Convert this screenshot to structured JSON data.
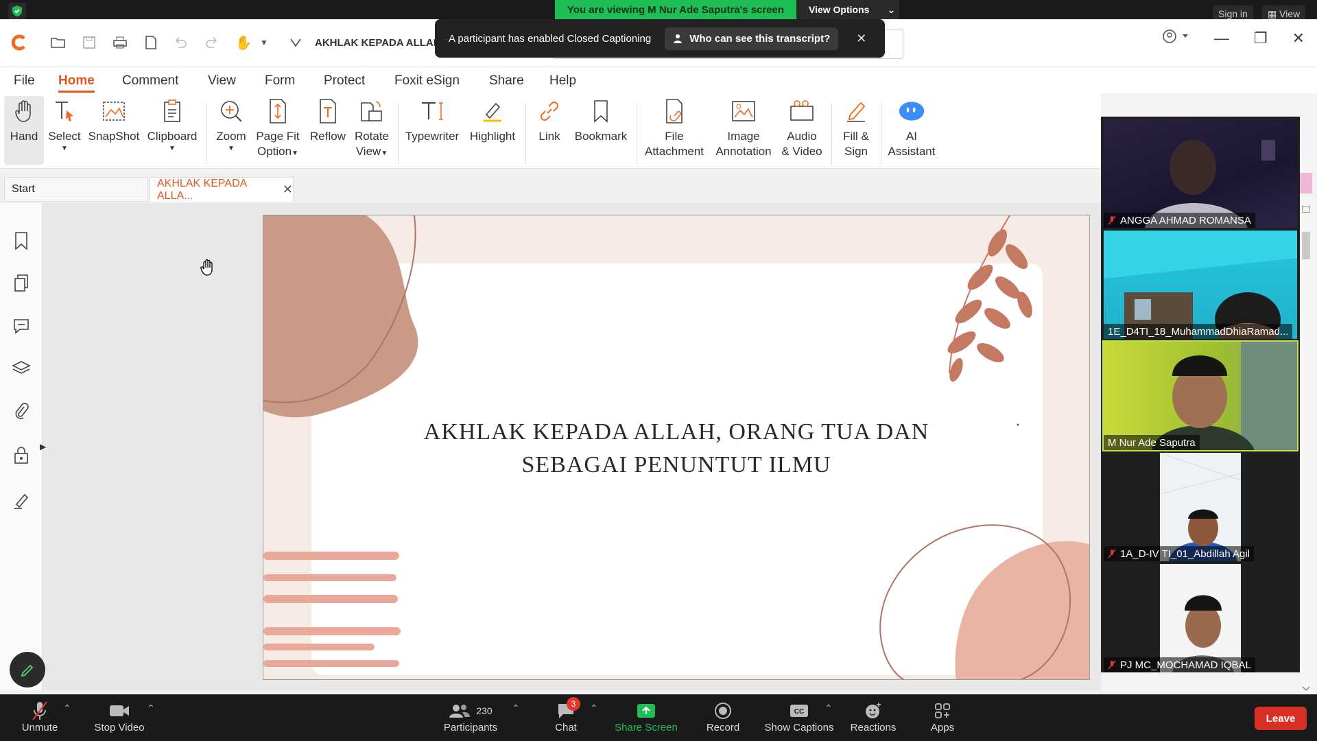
{
  "zoom_top": {
    "viewing_text": "You are viewing M Nur Ade Saputra's screen",
    "view_options": "View Options",
    "sign_in": "Sign in",
    "view": "View"
  },
  "caption_toast": {
    "message": "A participant has enabled Closed Captioning",
    "who_label": "Who can see this transcript?"
  },
  "foxit": {
    "doc_title_short": "AKHLAK KEPADA ALLAH,",
    "menu": [
      "File",
      "Home",
      "Comment",
      "View",
      "Form",
      "Protect",
      "Foxit eSign",
      "Share",
      "Help"
    ],
    "active_menu": "Home",
    "tools": {
      "hand": "Hand",
      "select": "Select",
      "snapshot": "SnapShot",
      "clipboard": "Clipboard",
      "zoom": "Zoom",
      "pagefit_1": "Page Fit",
      "pagefit_2": "Option",
      "reflow": "Reflow",
      "rotate_1": "Rotate",
      "rotate_2": "View",
      "typewriter": "Typewriter",
      "highlight": "Highlight",
      "link": "Link",
      "bookmark": "Bookmark",
      "fileatt_1": "File",
      "fileatt_2": "Attachment",
      "imageann_1": "Image",
      "imageann_2": "Annotation",
      "audio_1": "Audio",
      "audio_2": "& Video",
      "fillsign_1": "Fill &",
      "fillsign_2": "Sign",
      "ai_1": "AI",
      "ai_2": "Assistant"
    },
    "tabs": {
      "start": "Start",
      "doc": "AKHLAK KEPADA ALLA..."
    },
    "slide": {
      "line1": "AKHLAK KEPADA ALLAH, ORANG TUA DAN",
      "line2": "SEBAGAI PENUNTUT ILMU",
      "colors": {
        "blob": "#c99a85",
        "stripe": "#e8a99b",
        "leaf": "#c47a62",
        "bg": "#f7ebe5"
      }
    }
  },
  "gallery": {
    "participants": [
      {
        "name": "ANGGA AHMAD ROMANSA",
        "muted": true
      },
      {
        "name": "1E_D4TI_18_MuhammadDhiaRamad...",
        "muted": false
      },
      {
        "name": "M Nur Ade Saputra",
        "muted": false,
        "active": true
      },
      {
        "name": "1A_D-IV TI_01_Abdillah Agil",
        "muted": true
      },
      {
        "name": "PJ MC_MOCHAMAD IQBAL",
        "muted": true
      }
    ]
  },
  "zoom_bottom": {
    "unmute": "Unmute",
    "stop_video": "Stop Video",
    "participants": "Participants",
    "participant_count": "230",
    "chat": "Chat",
    "chat_badge": "3",
    "share_screen": "Share Screen",
    "record": "Record",
    "show_captions": "Show Captions",
    "reactions": "Reactions",
    "apps": "Apps",
    "leave": "Leave",
    "share_color": "#1fbd55"
  }
}
